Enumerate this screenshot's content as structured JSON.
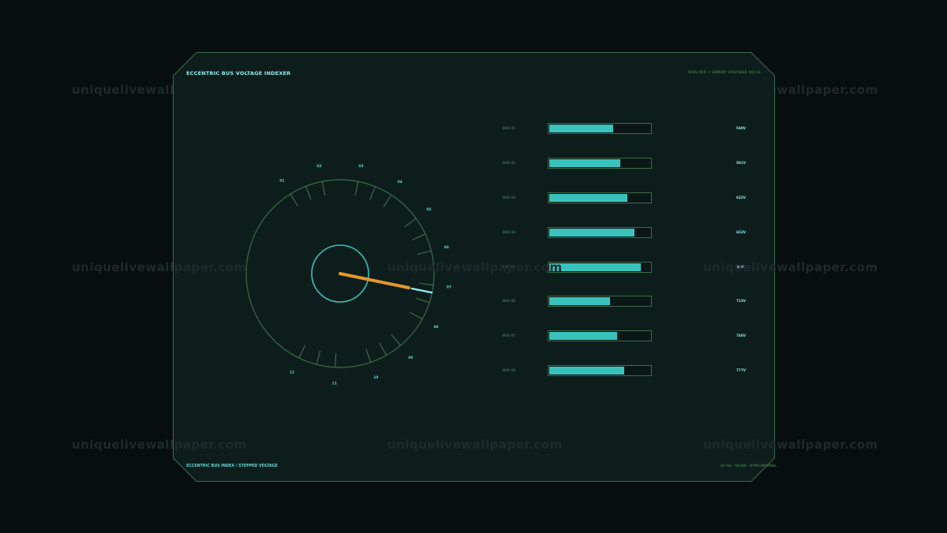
{
  "watermark": "uniquelivewallpaper.com",
  "header": {
    "title": "ECCENTRIC BUS VOLTAGE INDEXER",
    "status": "BUS-IDX // ARRAY VOLTAGE 08/16"
  },
  "footer": {
    "left": "ECCENTRIC BUS INDEX / STEPPED VOLTAGE",
    "right": "20 Hz · 08:08 · SYNCHRONAL"
  },
  "dial": {
    "tick_labels": [
      "01",
      "02",
      "03",
      "04",
      "05",
      "06",
      "07",
      "08",
      "09",
      "10",
      "11",
      "12"
    ],
    "pointer_position": "07",
    "colors": {
      "ring": "#3c6b48",
      "hub": "#39c2bc",
      "needle": "#e7962d",
      "needle_tip": "#8ff0ee"
    }
  },
  "buses": [
    {
      "label": "BUS 01",
      "level": 0.63,
      "value": "540V"
    },
    {
      "label": "BUS 02",
      "level": 0.7,
      "value": "591V"
    },
    {
      "label": "BUS 03",
      "level": 0.77,
      "value": "632V"
    },
    {
      "label": "BUS 04",
      "level": 0.84,
      "value": "653V"
    },
    {
      "label": "BUS 05",
      "level": 0.91,
      "value": "689V"
    },
    {
      "label": "BUS 06",
      "level": 0.6,
      "value": "715V"
    },
    {
      "label": "BUS 07",
      "level": 0.67,
      "value": "746V"
    },
    {
      "label": "BUS 08",
      "level": 0.74,
      "value": "777V"
    }
  ],
  "colors": {
    "accent": "#39c2bc",
    "frame": "#3c6b48",
    "background": "#0d1d1c"
  }
}
